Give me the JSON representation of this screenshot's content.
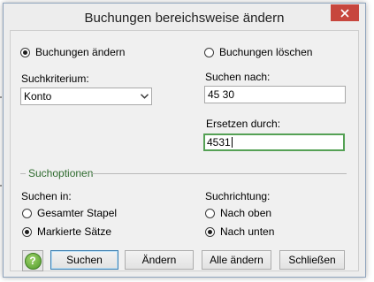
{
  "window": {
    "title": "Buchungen bereichsweise ändern",
    "close_icon": "close-icon"
  },
  "mode": {
    "change_label": "Buchungen ändern",
    "delete_label": "Buchungen löschen",
    "selected": "change"
  },
  "criteria": {
    "label": "Suchkriterium:",
    "value": "Konto"
  },
  "search": {
    "label": "Suchen nach:",
    "value": "45 30"
  },
  "replace": {
    "label": "Ersetzen durch:",
    "value": "4531"
  },
  "options": {
    "group_title": "Suchoptionen",
    "search_in_label": "Suchen in:",
    "search_in_items": [
      "Gesamter Stapel",
      "Markierte Sätze"
    ],
    "search_in_selected": 1,
    "direction_label": "Suchrichtung:",
    "direction_items": [
      "Nach oben",
      "Nach unten"
    ],
    "direction_selected": 1
  },
  "buttons": {
    "help_symbol": "?",
    "search": "Suchen",
    "change": "Ändern",
    "change_all": "Alle ändern",
    "close": "Schließen"
  },
  "colors": {
    "close_button": "#c7463d",
    "focus_border": "#55a155",
    "group_title": "#2e6b2e",
    "help_icon": "#5aa533"
  }
}
